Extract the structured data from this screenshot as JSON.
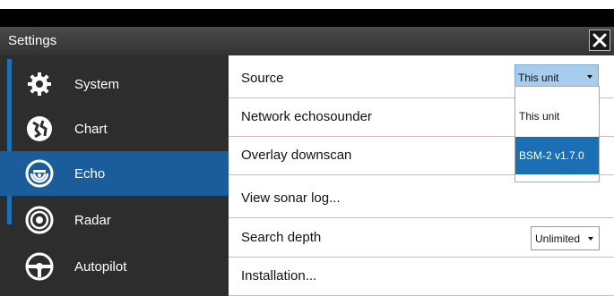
{
  "window": {
    "title": "Settings"
  },
  "sidebar": {
    "items": [
      {
        "label": "System",
        "icon": "gear-icon"
      },
      {
        "label": "Chart",
        "icon": "chart-icon"
      },
      {
        "label": "Echo",
        "icon": "echo-icon",
        "active": true
      },
      {
        "label": "Radar",
        "icon": "radar-icon"
      },
      {
        "label": "Autopilot",
        "icon": "autopilot-icon"
      }
    ]
  },
  "settings": {
    "rows": [
      {
        "label": "Source"
      },
      {
        "label": "Network echosounder"
      },
      {
        "label": "Overlay downscan"
      },
      {
        "label": "View sonar log..."
      },
      {
        "label": "Search depth"
      },
      {
        "label": "Installation..."
      }
    ],
    "source": {
      "value": "This unit",
      "options": [
        "This unit",
        "BSM-2 v1.7.0"
      ],
      "highlighted": "BSM-2 v1.7.0"
    },
    "search_depth": {
      "value": "Unlimited"
    }
  },
  "colors": {
    "accent": "#1a5d9a",
    "selection": "#1a6fb5",
    "titlebar": "#3d3d3d"
  }
}
